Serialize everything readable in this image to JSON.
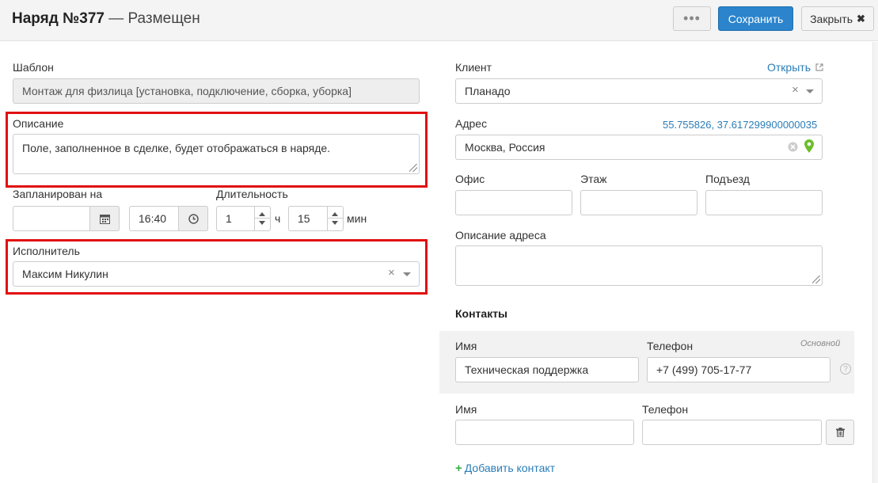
{
  "header": {
    "title_number": "Наряд №377",
    "title_separator": "—",
    "title_status": "Размещен",
    "more_label": "•••",
    "save_label": "Сохранить",
    "close_label": "Закрыть",
    "close_icon": "✖"
  },
  "left": {
    "template": {
      "label": "Шаблон",
      "value": "Монтаж для физлица [установка, подключение, сборка, уборка]"
    },
    "description": {
      "label": "Описание",
      "value": "Поле, заполненное в сделке, будет отображаться в наряде."
    },
    "scheduled": {
      "label": "Запланирован на",
      "date_value": "",
      "time_value": "16:40"
    },
    "duration": {
      "label": "Длительность",
      "hours": "1",
      "hours_unit": "ч",
      "minutes": "15",
      "minutes_unit": "мин"
    },
    "assignee": {
      "label": "Исполнитель",
      "value": "Максим Никулин",
      "clear": "×"
    }
  },
  "right": {
    "client": {
      "label": "Клиент",
      "open_link": "Открыть",
      "value": "Планадо",
      "clear": "×"
    },
    "address": {
      "label": "Адрес",
      "coords": "55.755826, 37.617299900000035",
      "value": "Москва, Россия"
    },
    "office": {
      "label": "Офис",
      "value": ""
    },
    "floor": {
      "label": "Этаж",
      "value": ""
    },
    "entrance": {
      "label": "Подъезд",
      "value": ""
    },
    "address_desc": {
      "label": "Описание адреса",
      "value": ""
    }
  },
  "contacts": {
    "title": "Контакты",
    "primary_label": "Основной",
    "help": "?",
    "rows": [
      {
        "name_label": "Имя",
        "phone_label": "Телефон",
        "name": "Техническая поддержка",
        "phone": "+7 (499) 705-17-77"
      },
      {
        "name_label": "Имя",
        "phone_label": "Телефон",
        "name": "",
        "phone": ""
      }
    ],
    "add_label": "Добавить контакт"
  },
  "icons": {
    "calendar": "calendar-icon",
    "clock": "clock-icon",
    "map_pin": "map-pin-icon",
    "trash": "trash-icon",
    "external": "external-link-icon"
  },
  "colors": {
    "accent": "#2b84cc",
    "link": "#2a7db8",
    "highlight": "#e01010",
    "pin": "#6cbf2a",
    "add": "#3ab04a"
  }
}
